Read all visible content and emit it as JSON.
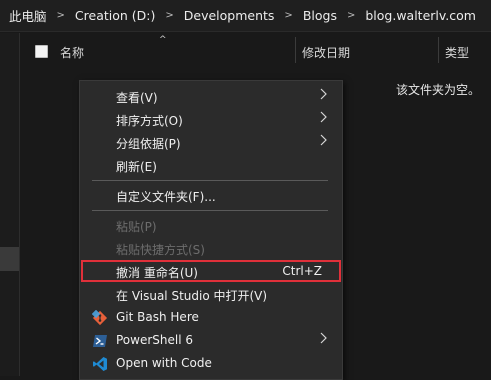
{
  "breadcrumb": {
    "items": [
      "此电脑",
      "Creation (D:)",
      "Developments",
      "Blogs",
      "blog.walterlv.com"
    ],
    "separator": ">"
  },
  "columns": {
    "name": "名称",
    "date_modified": "修改日期",
    "type": "类型"
  },
  "folder": {
    "empty_message": "该文件夹为空。"
  },
  "context_menu": {
    "view": "查看(V)",
    "sort_by": "排序方式(O)",
    "group_by": "分组依据(P)",
    "refresh": "刷新(E)",
    "customize_folder": "自定义文件夹(F)...",
    "paste": "粘贴(P)",
    "paste_shortcut": "粘贴快捷方式(S)",
    "undo_rename": "撤消 重命名(U)",
    "undo_shortcut": "Ctrl+Z",
    "open_in_vs": "在 Visual Studio 中打开(V)",
    "git_bash": "Git Bash Here",
    "powershell": "PowerShell 6",
    "open_with_code": "Open with Code"
  },
  "colors": {
    "highlight_border": "#e0303a",
    "menu_bg": "#2b2b2b",
    "window_bg": "#191919"
  },
  "icons": {
    "submenu": "chevron-right",
    "git": "git-diamond",
    "powershell": "powershell-prompt",
    "vscode": "vscode-logo"
  }
}
